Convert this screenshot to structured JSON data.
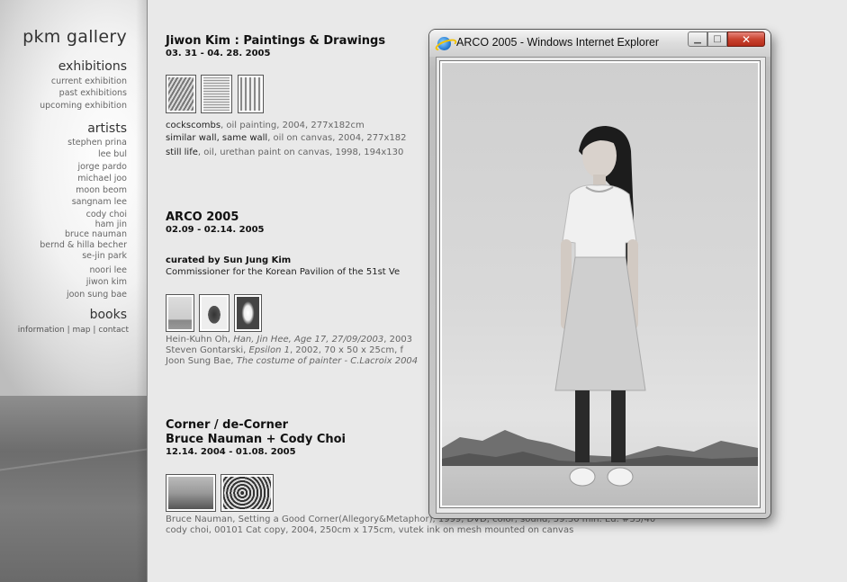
{
  "sidebar": {
    "logo": "pkm gallery",
    "exhibitions": {
      "heading": "exhibitions",
      "items": [
        "current exhibition",
        "past exhibitions",
        "upcoming exhibition"
      ]
    },
    "artists": {
      "heading": "artists",
      "items": [
        "stephen prina",
        "lee bul",
        "jorge pardo",
        "michael joo",
        "moon beom",
        "sangnam lee",
        "cody choi",
        "ham jin",
        "bruce nauman",
        "bernd & hilla becher",
        "se-jin park",
        "noori lee",
        "jiwon kim",
        "joon sung bae"
      ]
    },
    "books": {
      "heading": "books"
    },
    "footer": [
      "information",
      "map",
      "contact"
    ],
    "footer_sep": "|"
  },
  "main": {
    "ex1": {
      "title": "Jiwon Kim : Paintings & Drawings",
      "date": "03. 31 - 04. 28. 2005",
      "captions": [
        {
          "name": "cockscombs",
          "rest": ", oil painting, 2004, 277x182cm"
        },
        {
          "name": "similar wall, same wall",
          "rest": ", oil on canvas, 2004, 277x182"
        },
        {
          "name": "still life",
          "rest": ", oil, urethan paint on canvas, 1998, 194x130"
        }
      ]
    },
    "ex2": {
      "title": "ARCO 2005",
      "date": "02.09 - 02.14. 2005",
      "curated": "curated by Sun Jung Kim",
      "commissioner": "Commissioner for the Korean Pavilion of the 51st Ve",
      "captions": [
        {
          "artist": "Hein-Kuhn Oh, ",
          "work": "Han, Jin Hee, Age 17, 27/09/2003",
          "rest": ", 2003"
        },
        {
          "artist": "Steven Gontarski, ",
          "work": "Epsilon 1",
          "rest": ", 2002, 70 x 50 x 25cm, f"
        },
        {
          "artist": "Joon Sung Bae, ",
          "work": "The costume of painter - C.Lacroix 2004",
          "rest": ""
        }
      ]
    },
    "ex3": {
      "title1": "Corner / de-Corner",
      "title2": "Bruce Nauman + Cody Choi",
      "date": "12.14. 2004 - 01.08. 2005",
      "captions": [
        {
          "name": "Bruce Nauman",
          "rest": ", Setting a Good Corner(Allegory&Metaphor), 1999, DVD, color, sound, 59:30 min. Ed. #35/40"
        },
        {
          "name": "cody choi",
          "rest": ", 00101 Cat copy, 2004, 250cm x 175cm, vutek ink on mesh mounted on canvas"
        }
      ]
    }
  },
  "popup": {
    "title": "ARCO 2005 - Windows Internet Explorer",
    "buttons": {
      "minimize": "▁",
      "maximize": "□",
      "close": "✕"
    }
  }
}
